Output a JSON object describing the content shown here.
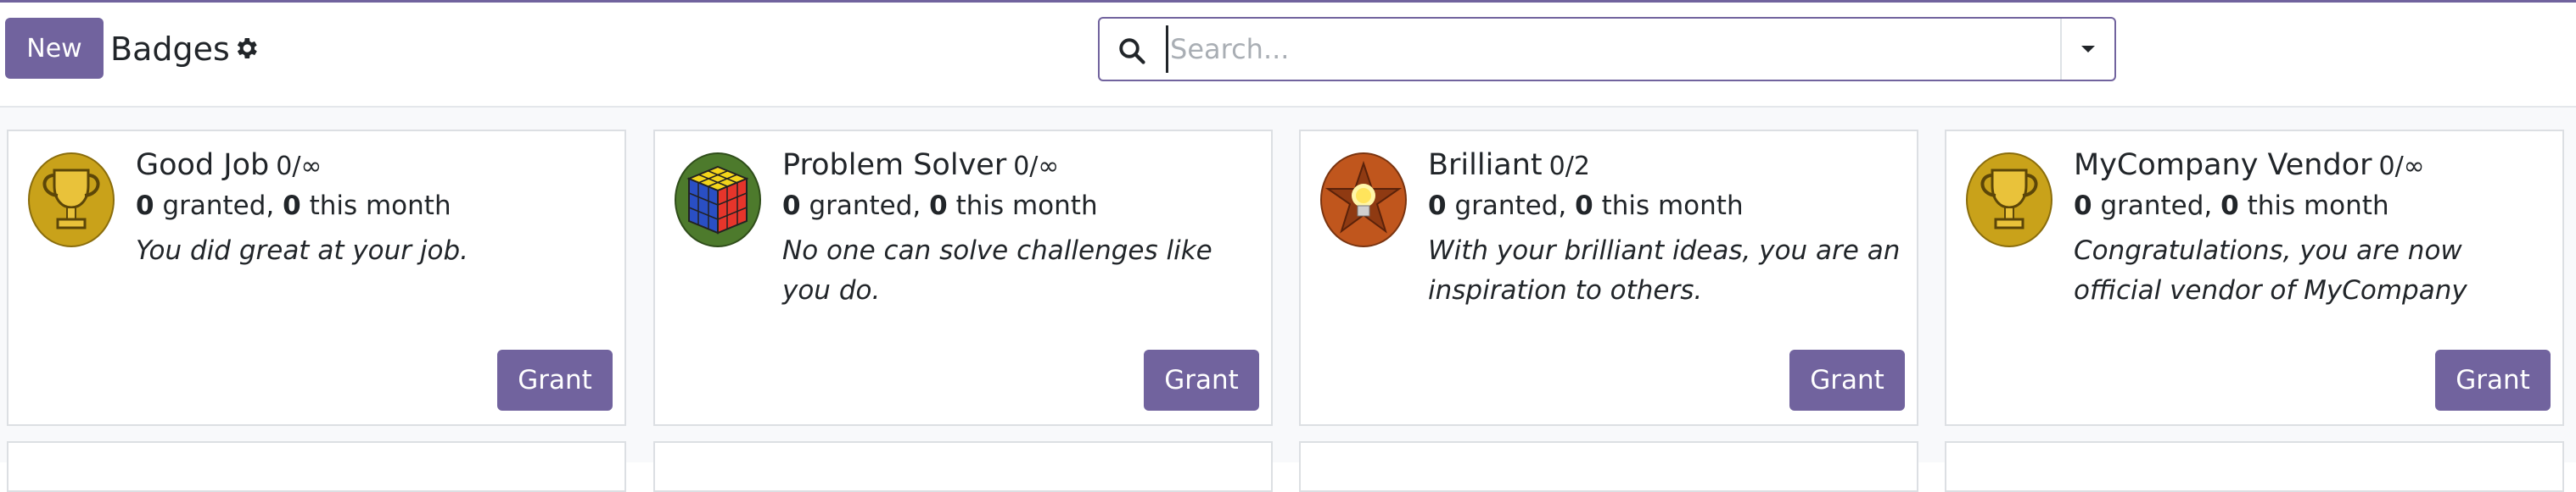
{
  "control_panel": {
    "new_label": "New",
    "title": "Badges",
    "search_placeholder": "Search..."
  },
  "colors": {
    "accent": "#71639e",
    "gold": "#c9a21a",
    "orange": "#c0561d",
    "green": "#4d7a2c"
  },
  "cards": [
    {
      "name": "Good Job",
      "limit": "0/∞",
      "granted": "0",
      "granted_label": "granted,",
      "month": "0",
      "month_label": "this month",
      "description": "You did great at your job.",
      "icon": "trophy-icon",
      "grant_label": "Grant"
    },
    {
      "name": "Problem Solver",
      "limit": "0/∞",
      "granted": "0",
      "granted_label": "granted,",
      "month": "0",
      "month_label": "this month",
      "description": "No one can solve challenges like you do.",
      "icon": "rubiks-cube-icon",
      "grant_label": "Grant"
    },
    {
      "name": "Brilliant",
      "limit": "0/2",
      "granted": "0",
      "granted_label": "granted,",
      "month": "0",
      "month_label": "this month",
      "description": "With your brilliant ideas, you are an inspiration to others.",
      "icon": "lightbulb-star-icon",
      "grant_label": "Grant"
    },
    {
      "name": "MyCompany Vendor",
      "limit": "0/∞",
      "granted": "0",
      "granted_label": "granted,",
      "month": "0",
      "month_label": "this month",
      "description": "Congratulations, you are now official vendor of MyCompany",
      "icon": "trophy-icon",
      "grant_label": "Grant"
    }
  ]
}
